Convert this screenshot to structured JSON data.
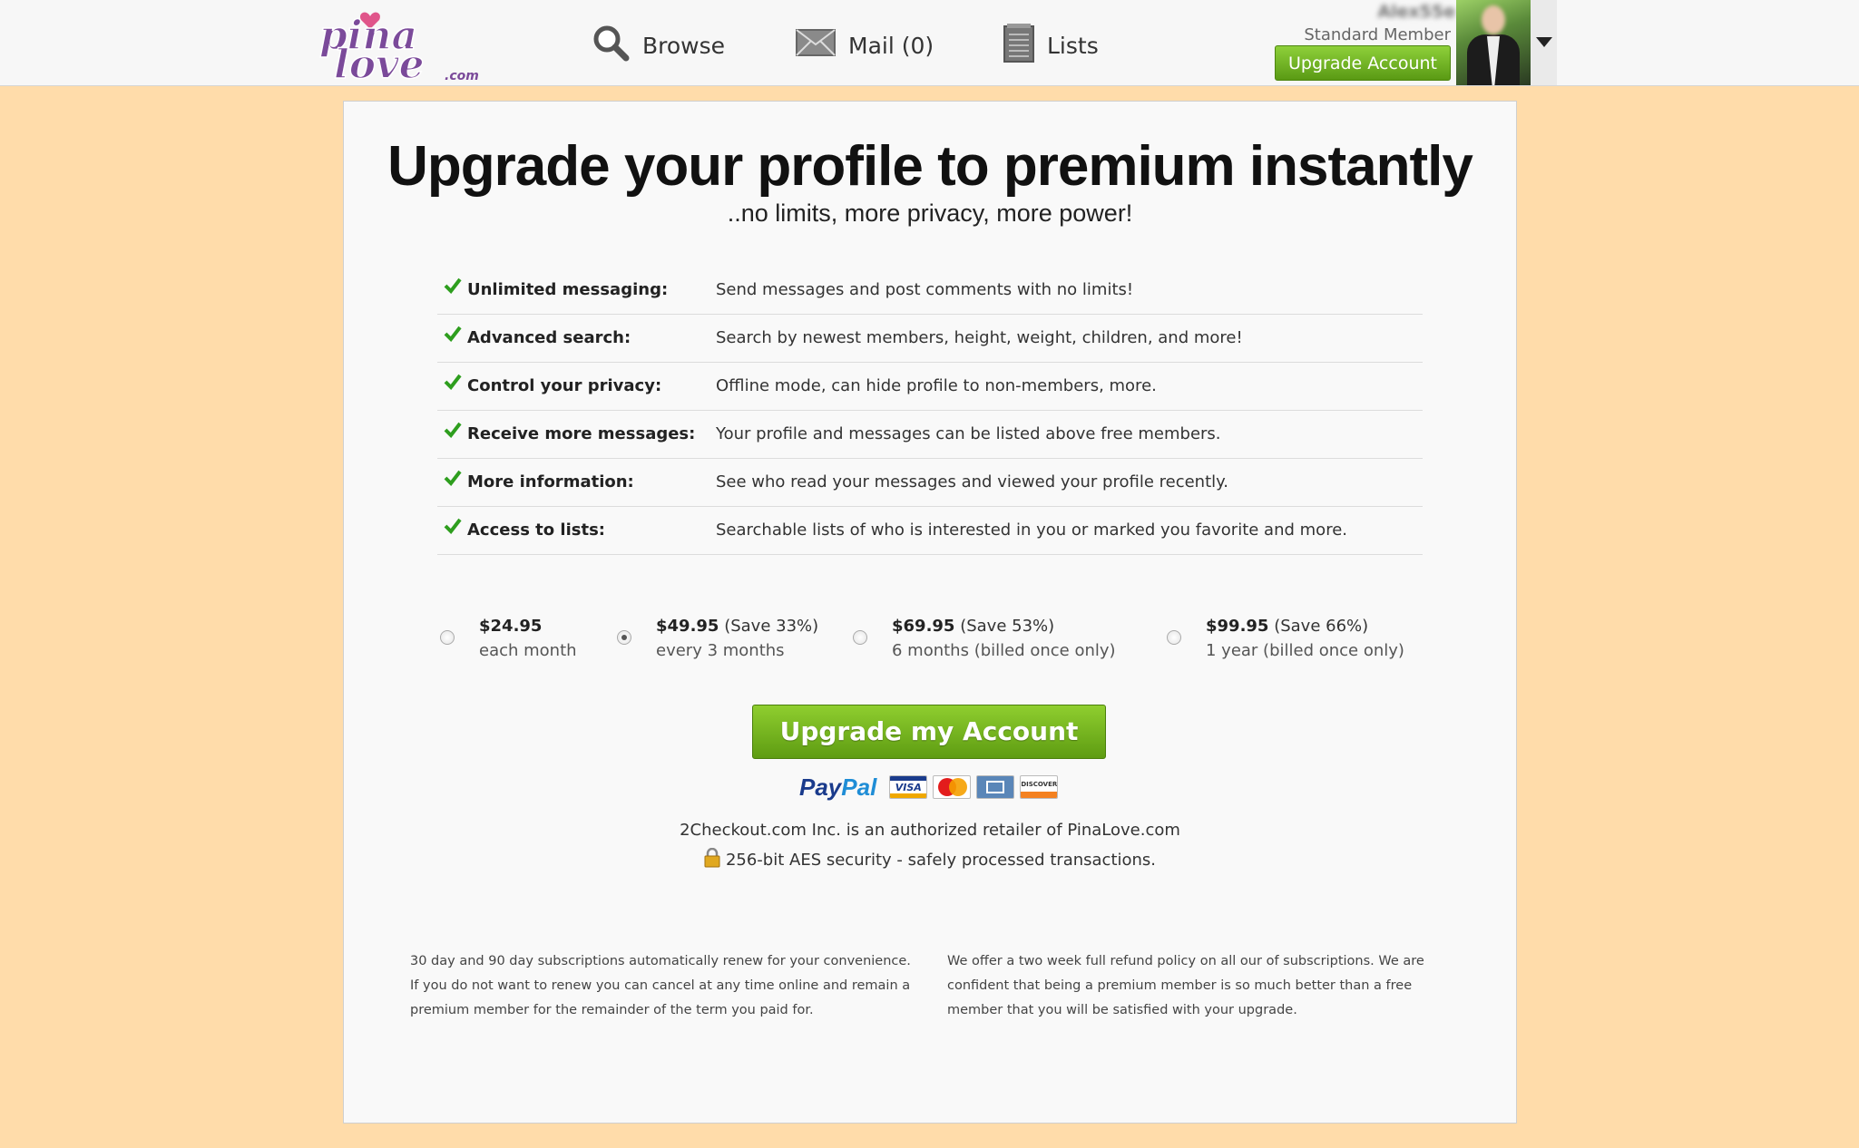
{
  "header": {
    "logo_text": "PinaLove.com",
    "nav": {
      "browse": "Browse",
      "mail": "Mail (0)",
      "lists": "Lists"
    },
    "user": {
      "name": "Alex55e",
      "membership": "Standard Member",
      "upgrade_label": "Upgrade Account"
    }
  },
  "main": {
    "title": "Upgrade your profile to premium instantly",
    "subtitle": "..no limits, more privacy, more power!",
    "features": [
      {
        "name": "Unlimited messaging:",
        "description": "Send messages and post comments with no limits!"
      },
      {
        "name": "Advanced search:",
        "description": "Search by newest members, height, weight, children, and more!"
      },
      {
        "name": "Control your privacy:",
        "description": "Offline mode, can hide profile to non-members, more."
      },
      {
        "name": "Receive more messages:",
        "description": "Your profile and messages can be listed above free members."
      },
      {
        "name": "More information:",
        "description": "See who read your messages and viewed your profile recently."
      },
      {
        "name": "Access to lists:",
        "description": "Searchable lists of who is interested in you or marked you favorite and more."
      }
    ],
    "plans": [
      {
        "price": "$24.95",
        "save": "",
        "term": "each month",
        "selected": false
      },
      {
        "price": "$49.95",
        "save": "(Save 33%)",
        "term": "every 3 months",
        "selected": true
      },
      {
        "price": "$69.95",
        "save": "(Save 53%)",
        "term": "6 months (billed once only)",
        "selected": false
      },
      {
        "price": "$99.95",
        "save": "(Save 66%)",
        "term": "1 year (billed once only)",
        "selected": false
      }
    ],
    "upgrade_button": "Upgrade my Account",
    "payment": {
      "paypal_pay": "Pay",
      "paypal_pal": "Pal",
      "visa": "VISA",
      "discover": "DISCOVER"
    },
    "retailer_text": "2Checkout.com Inc. is an authorized retailer of PinaLove.com",
    "security_text": "256-bit AES security - safely processed transactions.",
    "fine_print_left": "30 day and 90 day subscriptions automatically renew for your convenience. If you do not want to renew you can cancel at any time online and remain a premium member for the remainder of the term you paid for.",
    "fine_print_right": "We offer a two week full refund policy on all our of subscriptions. We are confident that being a premium member is so much better than a free member that you will be satisfied with your upgrade."
  },
  "colors": {
    "page_background": "#ffdcaa",
    "accent_green": "#6aab1c",
    "logo_purple": "#7b4a9a",
    "check_green": "#2e9e1e"
  }
}
